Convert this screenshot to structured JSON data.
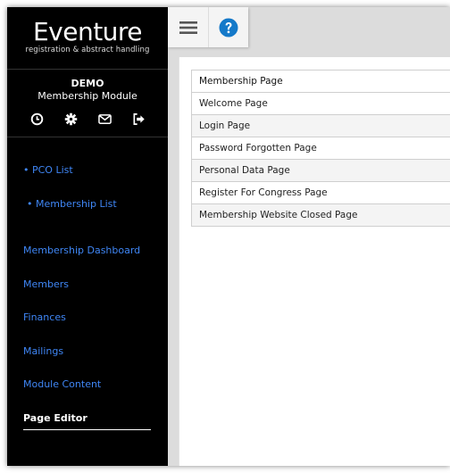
{
  "app": {
    "logo_name": "Eventure",
    "logo_tagline": "registration & abstract handling"
  },
  "sidebar": {
    "organization": "DEMO",
    "module": "Membership Module",
    "icon_buttons": [
      "clock-icon",
      "gear-icon",
      "envelope-icon",
      "sign-out-icon"
    ],
    "sub_items": [
      {
        "label": "• PCO List"
      },
      {
        "label": "• Membership List"
      }
    ],
    "items": [
      {
        "label": "Membership Dashboard"
      },
      {
        "label": "Members"
      },
      {
        "label": "Finances"
      },
      {
        "label": "Mailings"
      },
      {
        "label": "Module Content"
      },
      {
        "label": "Page Editor",
        "active": true
      }
    ]
  },
  "toolbar": {
    "menu_icon": "hamburger-menu-icon",
    "help_icon": "help-icon"
  },
  "pages_table": {
    "rows": [
      "Membership Page",
      "Welcome Page",
      "Login Page",
      "Password Forgotten Page",
      "Personal Data Page",
      "Register For Congress Page",
      "Membership Website Closed Page"
    ]
  },
  "colors": {
    "sidebar_bg": "#000000",
    "nav_link": "#3f86f5",
    "help_blue": "#1479c9",
    "toolbar_icon": "#555555"
  }
}
